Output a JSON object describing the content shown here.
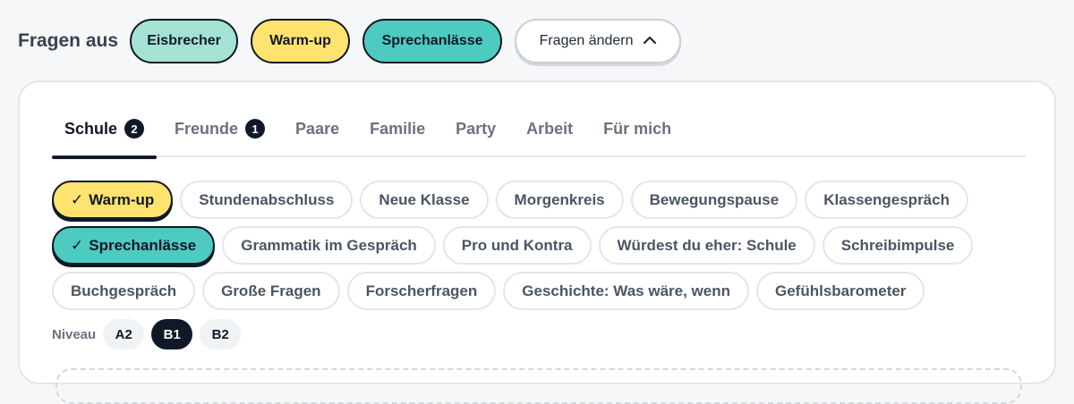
{
  "header": {
    "label": "Fragen aus",
    "selected_sets": [
      {
        "label": "Eisbrecher"
      },
      {
        "label": "Warm-up"
      },
      {
        "label": "Sprechanlässe"
      }
    ],
    "change_button": {
      "label": "Fragen ändern",
      "icon": "chevron-up-icon"
    }
  },
  "tabs": [
    {
      "label": "Schule",
      "badge": "2",
      "active": true
    },
    {
      "label": "Freunde",
      "badge": "1",
      "active": false
    },
    {
      "label": "Paare",
      "active": false
    },
    {
      "label": "Familie",
      "active": false
    },
    {
      "label": "Party",
      "active": false
    },
    {
      "label": "Arbeit",
      "active": false
    },
    {
      "label": "Für mich",
      "active": false
    }
  ],
  "chips": [
    {
      "label": "Warm-up",
      "selected": true
    },
    {
      "label": "Stundenabschluss",
      "selected": false
    },
    {
      "label": "Neue Klasse",
      "selected": false
    },
    {
      "label": "Morgenkreis",
      "selected": false
    },
    {
      "label": "Bewegungspause",
      "selected": false
    },
    {
      "label": "Klassengespräch",
      "selected": false
    },
    {
      "label": "Sprechanlässe",
      "selected": true
    },
    {
      "label": "Grammatik im Gespräch",
      "selected": false
    },
    {
      "label": "Pro und Kontra",
      "selected": false
    },
    {
      "label": "Würdest du eher: Schule",
      "selected": false
    },
    {
      "label": "Schreibimpulse",
      "selected": false
    },
    {
      "label": "Buchgespräch",
      "selected": false
    },
    {
      "label": "Große Fragen",
      "selected": false
    },
    {
      "label": "Forscherfragen",
      "selected": false
    },
    {
      "label": "Geschichte: Was wäre, wenn",
      "selected": false
    },
    {
      "label": "Gefühlsbarometer",
      "selected": false
    }
  ],
  "check_mark": "✓",
  "level": {
    "label": "Niveau",
    "options": [
      "A2",
      "B1",
      "B2"
    ],
    "selected": "B1"
  },
  "colors": {
    "eisbrecher": "#a4e3d3",
    "warmup": "#ffe36e",
    "sprechanlaesse": "#4ecbc0",
    "dark": "#111827"
  }
}
